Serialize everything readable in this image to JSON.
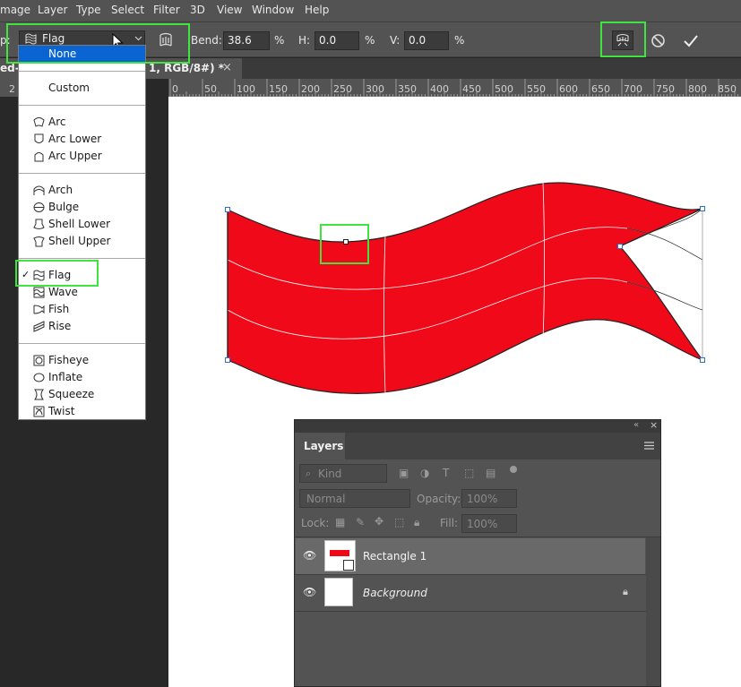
{
  "menubar": {
    "items": [
      "mage",
      "Layer",
      "Type",
      "Select",
      "Filter",
      "3D",
      "View",
      "Window",
      "Help"
    ]
  },
  "options": {
    "warp_label_prefix": "p:",
    "warp_value": "Flag",
    "bend_label": "Bend:",
    "bend_value": "38.6",
    "h_label": "H:",
    "h_value": "0.0",
    "v_label": "V:",
    "v_value": "0.0",
    "percent": "%"
  },
  "tab": {
    "title_prefix": "ed-",
    "title_suffix": "1, RGB/8#) *",
    "close": "×"
  },
  "ruler": {
    "labels": [
      "2",
      "0",
      "50",
      "100",
      "150",
      "200",
      "250",
      "300",
      "350",
      "400",
      "450",
      "500",
      "550",
      "600",
      "650",
      "700",
      "750",
      "800",
      "850"
    ]
  },
  "dropdown": {
    "none": "None",
    "custom": "Custom",
    "items": [
      {
        "label": "Arc",
        "icon": "arc-icon"
      },
      {
        "label": "Arc Lower",
        "icon": "arc-lower-icon"
      },
      {
        "label": "Arc Upper",
        "icon": "arc-upper-icon"
      },
      {
        "label": "Arch",
        "icon": "arch-icon"
      },
      {
        "label": "Bulge",
        "icon": "bulge-icon"
      },
      {
        "label": "Shell Lower",
        "icon": "shell-lower-icon"
      },
      {
        "label": "Shell Upper",
        "icon": "shell-upper-icon"
      },
      {
        "label": "Flag",
        "icon": "flag-icon"
      },
      {
        "label": "Wave",
        "icon": "wave-icon"
      },
      {
        "label": "Fish",
        "icon": "fish-icon"
      },
      {
        "label": "Rise",
        "icon": "rise-icon"
      },
      {
        "label": "Fisheye",
        "icon": "fisheye-icon"
      },
      {
        "label": "Inflate",
        "icon": "inflate-icon"
      },
      {
        "label": "Squeeze",
        "icon": "squeeze-icon"
      },
      {
        "label": "Twist",
        "icon": "twist-icon"
      }
    ],
    "checkmark": "✓"
  },
  "layers_panel": {
    "title": "Layers",
    "filter_kind": "Kind",
    "blend_mode": "Normal",
    "opacity_label": "Opacity:",
    "opacity_value": "100%",
    "lock_label": "Lock:",
    "fill_label": "Fill:",
    "fill_value": "100%",
    "layers": [
      {
        "name": "Rectangle 1"
      },
      {
        "name": "Background"
      }
    ]
  },
  "colors": {
    "flag_red": "#f00a19",
    "highlight_green": "#3fe43f",
    "selection_blue": "#0a64d2"
  }
}
